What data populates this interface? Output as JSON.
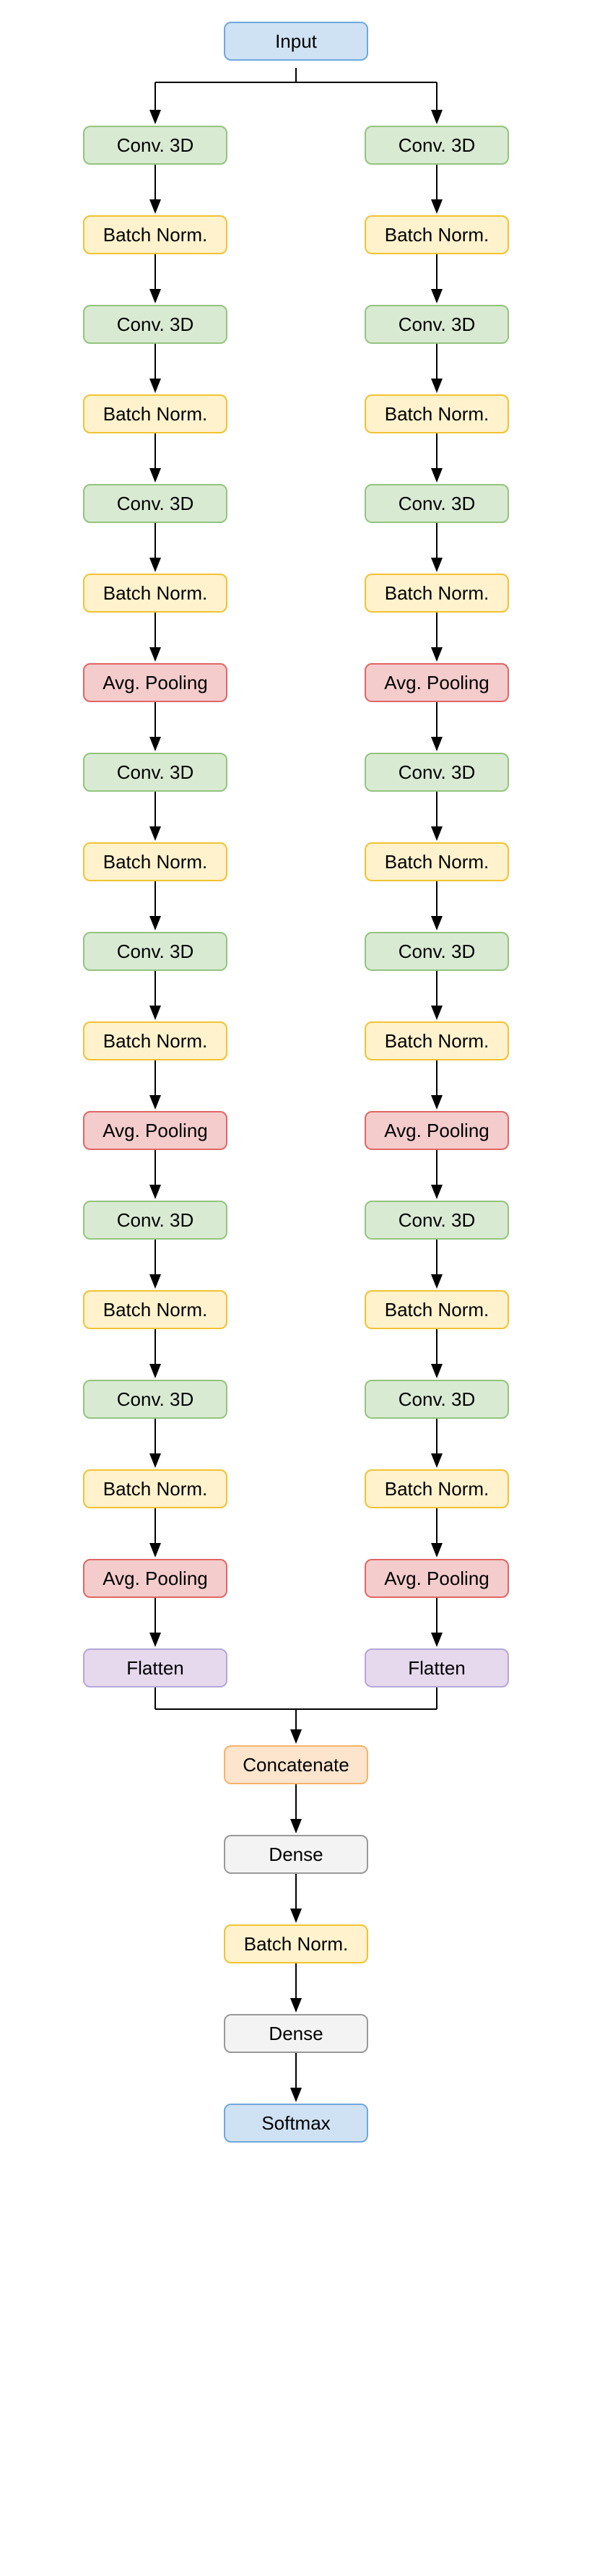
{
  "input": {
    "label": "Input"
  },
  "branch": [
    {
      "type": "conv",
      "label": "Conv. 3D"
    },
    {
      "type": "bn",
      "label": "Batch Norm."
    },
    {
      "type": "conv",
      "label": "Conv. 3D"
    },
    {
      "type": "bn",
      "label": "Batch Norm."
    },
    {
      "type": "conv",
      "label": "Conv. 3D"
    },
    {
      "type": "bn",
      "label": "Batch Norm."
    },
    {
      "type": "pool",
      "label": "Avg. Pooling"
    },
    {
      "type": "conv",
      "label": "Conv. 3D"
    },
    {
      "type": "bn",
      "label": "Batch Norm."
    },
    {
      "type": "conv",
      "label": "Conv. 3D"
    },
    {
      "type": "bn",
      "label": "Batch Norm."
    },
    {
      "type": "pool",
      "label": "Avg. Pooling"
    },
    {
      "type": "conv",
      "label": "Conv. 3D"
    },
    {
      "type": "bn",
      "label": "Batch Norm."
    },
    {
      "type": "conv",
      "label": "Conv. 3D"
    },
    {
      "type": "bn",
      "label": "Batch Norm."
    },
    {
      "type": "pool",
      "label": "Avg. Pooling"
    },
    {
      "type": "flat",
      "label": "Flatten"
    }
  ],
  "tail": [
    {
      "type": "concat",
      "label": "Concatenate"
    },
    {
      "type": "dense",
      "label": "Dense"
    },
    {
      "type": "bn",
      "label": "Batch Norm."
    },
    {
      "type": "dense",
      "label": "Dense"
    },
    {
      "type": "softmax",
      "label": "Softmax"
    }
  ]
}
